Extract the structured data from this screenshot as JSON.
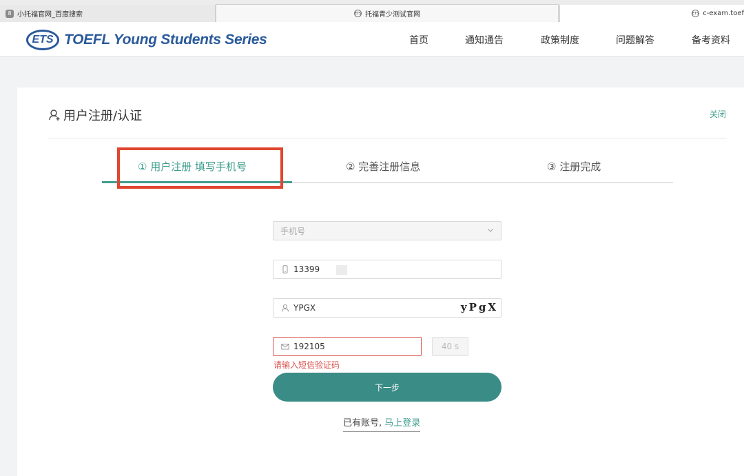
{
  "browser": {
    "tabs": [
      {
        "title": "小托福官网_百度搜索",
        "favicon": "8"
      },
      {
        "title": "托福青少测试官网",
        "favicon": "ets"
      },
      {
        "title": "c-exam.toef",
        "favicon": "ets"
      }
    ]
  },
  "header": {
    "logo_mark": "ETS",
    "logo_text": "TOEFL Young Students Series",
    "nav": [
      "首页",
      "通知通告",
      "政策制度",
      "问题解答",
      "备考资料"
    ]
  },
  "card": {
    "title": "用户注册/认证",
    "close_label": "关闭",
    "steps": [
      {
        "label": "① 用户注册 填写手机号",
        "active": true
      },
      {
        "label": "② 完善注册信息",
        "active": false
      },
      {
        "label": "③ 注册完成",
        "active": false
      }
    ],
    "form": {
      "country_placeholder": "手机号",
      "phone_value": "13399",
      "captcha_value": "YPGX",
      "captcha_image_text": "yPgX",
      "sms_code_value": "192105",
      "countdown_label": "40 s",
      "error_message": "请输入短信验证码",
      "next_label": "下一步",
      "login_prompt": "已有账号,",
      "login_link": "马上登录"
    }
  },
  "colors": {
    "accent": "#3f9d8e",
    "button": "#3a8c86",
    "error": "#d9534f",
    "highlight": "#e0452f",
    "brand": "#2a5a9a"
  }
}
